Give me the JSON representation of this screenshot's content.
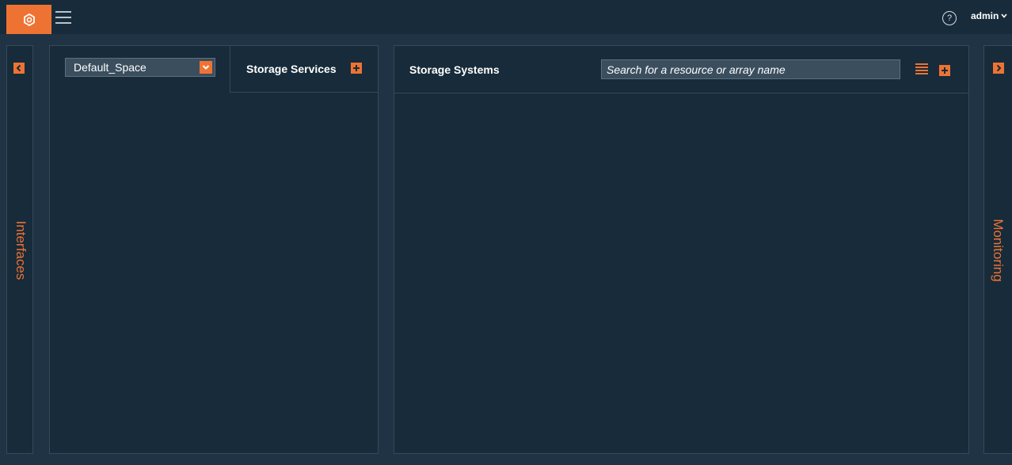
{
  "header": {
    "user": "admin",
    "help_symbol": "?",
    "colors": {
      "accent": "#ee7333",
      "bar": "#182b3a",
      "panel": "#172b3a"
    }
  },
  "sidebar_left": {
    "label": "Interfaces",
    "toggle_icon": "chevron-left-icon"
  },
  "sidebar_right": {
    "label": "Monitoring",
    "toggle_icon": "chevron-right-icon"
  },
  "left_panel": {
    "space_select_value": "Default_Space",
    "services_tab_label": "Storage Services"
  },
  "right_panel": {
    "title": "Storage Systems",
    "search_placeholder": "Search for a resource or array name"
  }
}
